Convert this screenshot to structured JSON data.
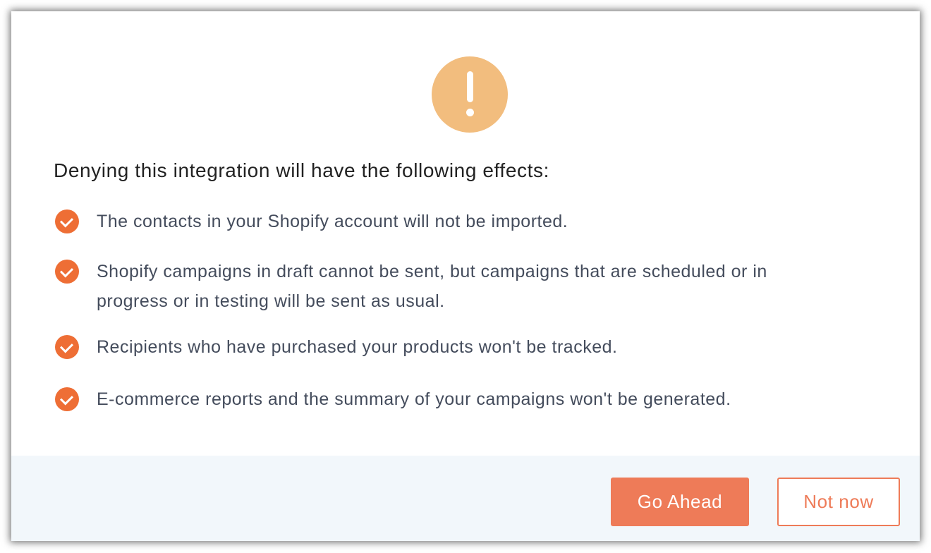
{
  "dialog": {
    "heading": "Denying this integration will have the following effects:",
    "icon": "warning-exclamation-icon",
    "effects": [
      {
        "icon": "check-circle-icon",
        "text": "The contacts in your Shopify account will not be imported."
      },
      {
        "icon": "check-circle-icon",
        "text": "Shopify campaigns in draft cannot be sent, but campaigns that are scheduled or in progress or in testing will be sent as usual."
      },
      {
        "icon": "check-circle-icon",
        "text": "Recipients who have purchased your products won't be tracked."
      },
      {
        "icon": "check-circle-icon",
        "text": "E-commerce reports and the summary of your campaigns won't be generated."
      }
    ],
    "buttons": {
      "primary_label": "Go Ahead",
      "secondary_label": "Not now"
    }
  },
  "colors": {
    "warning": "#f2bd7e",
    "accent": "#ee6e35",
    "button_primary": "#ee7b58",
    "footer_bg": "#f2f7fb",
    "text_heading": "#222222",
    "text_body": "#444c5c"
  }
}
